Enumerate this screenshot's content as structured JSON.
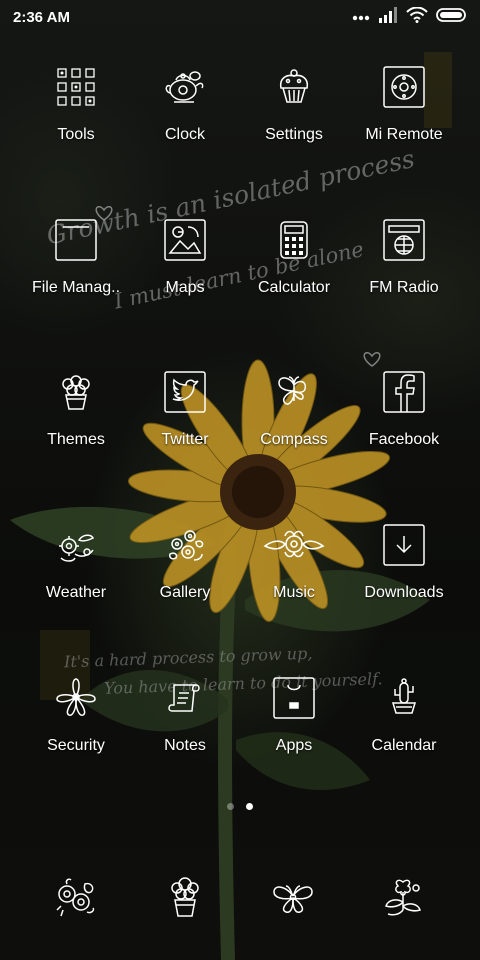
{
  "status_bar": {
    "time": "2:36 AM",
    "icons": [
      "dots-icon",
      "signal-icon",
      "wifi-icon",
      "battery-icon"
    ]
  },
  "wallpaper": {
    "quote_line1": "Growth is an isolated process",
    "quote_line2": "I must learn to be alone",
    "quote_line3": "It's a hard process to grow up,",
    "quote_line4": "You have to learn to do it yourself."
  },
  "apps": [
    {
      "label": "Tools",
      "icon": "tools-grid-icon"
    },
    {
      "label": "Clock",
      "icon": "clock-teapot-icon"
    },
    {
      "label": "Settings",
      "icon": "settings-cupcake-icon"
    },
    {
      "label": "Mi Remote",
      "icon": "remote-icon"
    },
    {
      "label": "File Manag..",
      "icon": "folder-icon"
    },
    {
      "label": "Maps",
      "icon": "maps-icon"
    },
    {
      "label": "Calculator",
      "icon": "calculator-icon"
    },
    {
      "label": "FM Radio",
      "icon": "radio-icon"
    },
    {
      "label": "Themes",
      "icon": "themes-flowerpot-icon"
    },
    {
      "label": "Twitter",
      "icon": "twitter-icon"
    },
    {
      "label": "Compass",
      "icon": "compass-butterfly-icon"
    },
    {
      "label": "Facebook",
      "icon": "facebook-icon"
    },
    {
      "label": "Weather",
      "icon": "weather-flowers-icon"
    },
    {
      "label": "Gallery",
      "icon": "gallery-flowers-icon"
    },
    {
      "label": "Music",
      "icon": "music-flowers-icon"
    },
    {
      "label": "Downloads",
      "icon": "download-icon"
    },
    {
      "label": "Security",
      "icon": "security-flower-icon"
    },
    {
      "label": "Notes",
      "icon": "notes-scroll-icon"
    },
    {
      "label": "Apps",
      "icon": "apps-bag-icon"
    },
    {
      "label": "Calendar",
      "icon": "calendar-cactus-icon"
    }
  ],
  "pages": {
    "count": 2,
    "active_index": 1
  },
  "dock": [
    {
      "icon": "phone-flowers-icon"
    },
    {
      "icon": "messages-flowerpot-icon"
    },
    {
      "icon": "browser-butterfly-icon"
    },
    {
      "icon": "camera-flowers-icon"
    }
  ],
  "colors": {
    "foreground": "#ffffff",
    "background": "#101010",
    "petal": "#c8a02c"
  }
}
